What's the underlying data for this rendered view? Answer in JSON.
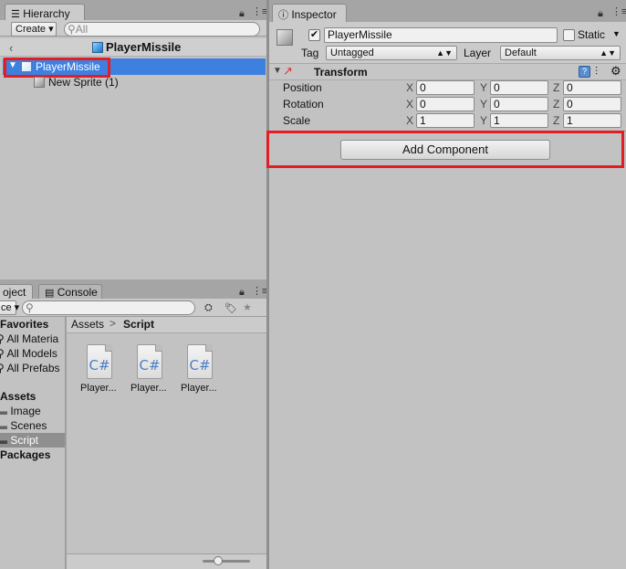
{
  "hierarchy": {
    "tab_label": "Hierarchy",
    "create_label": "Create ▾",
    "search_placeholder": "All",
    "scene_title": "PlayerMissile",
    "items": [
      {
        "label": "PlayerMissile",
        "selected": true
      },
      {
        "label": "New Sprite (1)",
        "selected": false
      }
    ]
  },
  "inspector": {
    "tab_label": "Inspector",
    "object_name": "PlayerMissile",
    "static_label": "Static",
    "tag_label": "Tag",
    "tag_value": "Untagged",
    "layer_label": "Layer",
    "layer_value": "Default",
    "transform": {
      "title": "Transform",
      "rows": [
        {
          "label": "Position",
          "x": "0",
          "y": "0",
          "z": "0"
        },
        {
          "label": "Rotation",
          "x": "0",
          "y": "0",
          "z": "0"
        },
        {
          "label": "Scale",
          "x": "1",
          "y": "1",
          "z": "1"
        }
      ],
      "axis_x": "X",
      "axis_y": "Y",
      "axis_z": "Z"
    },
    "add_component_label": "Add Component"
  },
  "project": {
    "tab_label": "oject",
    "console_tab_label": "Console",
    "create_label": "ce ▾",
    "favorites_header": "Favorites",
    "favorites": [
      "All Materia",
      "All Models",
      "All Prefabs"
    ],
    "assets_header": "Assets",
    "folders": [
      {
        "label": "Image",
        "selected": false
      },
      {
        "label": "Scenes",
        "selected": false
      },
      {
        "label": "Script",
        "selected": true
      }
    ],
    "packages_header": "Packages",
    "breadcrumb_root": "Assets",
    "breadcrumb_sep": ">",
    "breadcrumb_current": "Script",
    "files": [
      {
        "label": "Player...",
        "icon_text": "C#"
      },
      {
        "label": "Player...",
        "icon_text": "C#"
      },
      {
        "label": "Player...",
        "icon_text": "C#"
      }
    ]
  },
  "colors": {
    "selection": "#3d80df",
    "highlight_box": "#e41d25"
  }
}
